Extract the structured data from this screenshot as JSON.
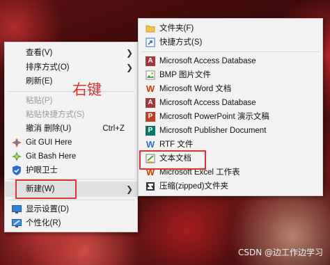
{
  "annotation": "右键",
  "watermark": "CSDN @边工作边学习",
  "context_menu": {
    "items": [
      {
        "label": "查看(V)",
        "has_submenu": true
      },
      {
        "label": "排序方式(O)",
        "has_submenu": true
      },
      {
        "label": "刷新(E)"
      },
      {
        "label": "粘贴(P)",
        "disabled": true
      },
      {
        "label": "粘贴快捷方式(S)",
        "disabled": true
      },
      {
        "label": "撤消 删除(U)",
        "shortcut": "Ctrl+Z"
      },
      {
        "label": "Git GUI Here",
        "icon": "git-gui-icon"
      },
      {
        "label": "Git Bash Here",
        "icon": "git-bash-icon"
      },
      {
        "label": "护眼卫士",
        "icon": "shield-icon"
      },
      {
        "label": "新建(W)",
        "has_submenu": true,
        "highlighted": true
      },
      {
        "label": "显示设置(D)",
        "icon": "display-icon"
      },
      {
        "label": "个性化(R)",
        "icon": "personalize-icon"
      }
    ]
  },
  "new_submenu": {
    "items": [
      {
        "label": "文件夹(F)",
        "icon": "folder-icon"
      },
      {
        "label": "快捷方式(S)",
        "icon": "shortcut-icon"
      },
      {
        "label": "Microsoft Access Database",
        "icon": "access-icon"
      },
      {
        "label": "BMP 图片文件",
        "icon": "bmp-icon"
      },
      {
        "label": "Microsoft Word 文档",
        "icon": "word-icon"
      },
      {
        "label": "Microsoft Access Database",
        "icon": "access-icon"
      },
      {
        "label": "Microsoft PowerPoint 演示文稿",
        "icon": "powerpoint-icon"
      },
      {
        "label": "Microsoft Publisher Document",
        "icon": "publisher-icon"
      },
      {
        "label": "RTF 文件",
        "icon": "rtf-icon"
      },
      {
        "label": "文本文档",
        "icon": "text-document-icon",
        "highlighted": true
      },
      {
        "label": "Microsoft Excel 工作表",
        "icon": "excel-icon"
      },
      {
        "label": "压缩(zipped)文件夹",
        "icon": "zip-folder-icon"
      }
    ]
  },
  "colors": {
    "highlight_box": "#e03030",
    "menu_bg": "#f2f2f2"
  }
}
